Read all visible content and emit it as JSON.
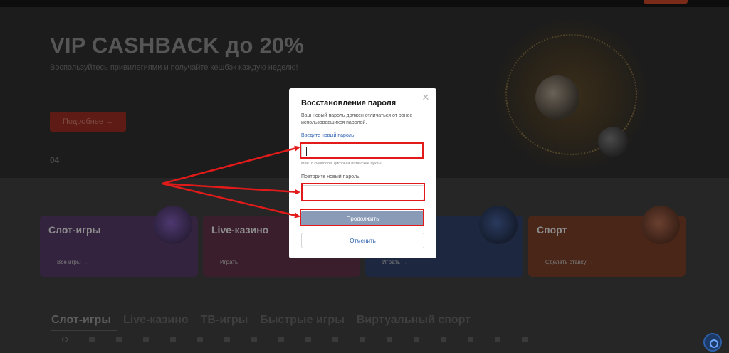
{
  "hero": {
    "title": "VIP CASHBACK до 20%",
    "subtitle": "Воспользуйтесь привилегиями и получайте кешбэк каждую неделю!",
    "button": "Подробнее →",
    "counter": "04"
  },
  "categories": [
    {
      "title": "Слот-игры",
      "link": "Все игры →"
    },
    {
      "title": "Live-казино",
      "link": "Играть →"
    },
    {
      "title": "",
      "link": "Играть →"
    },
    {
      "title": "Спорт",
      "link": "Сделать ставку →"
    }
  ],
  "tabs": [
    "Слот-игры",
    "Live-казино",
    "ТВ-игры",
    "Быстрые игры",
    "Виртуальный спорт"
  ],
  "modal": {
    "title": "Восстановление пароля",
    "close_icon": "close-icon",
    "description": "Ваш новый пароль должен отличаться от ранее использовавшихся паролей.",
    "new_password_label": "Введите новый пароль",
    "new_password_value": "",
    "hint": "Мин. 8 символов, цифры и латинские буквы",
    "repeat_password_label": "Повторите новый пароль",
    "repeat_password_value": "",
    "continue_button": "Продолжить",
    "cancel_button": "Отменить"
  },
  "colors": {
    "annotation": "#e21a1a",
    "link_blue": "#2b5fb0",
    "continue_button_bg": "#8a9bb8",
    "hero_button_bg": "#5e1a14"
  }
}
